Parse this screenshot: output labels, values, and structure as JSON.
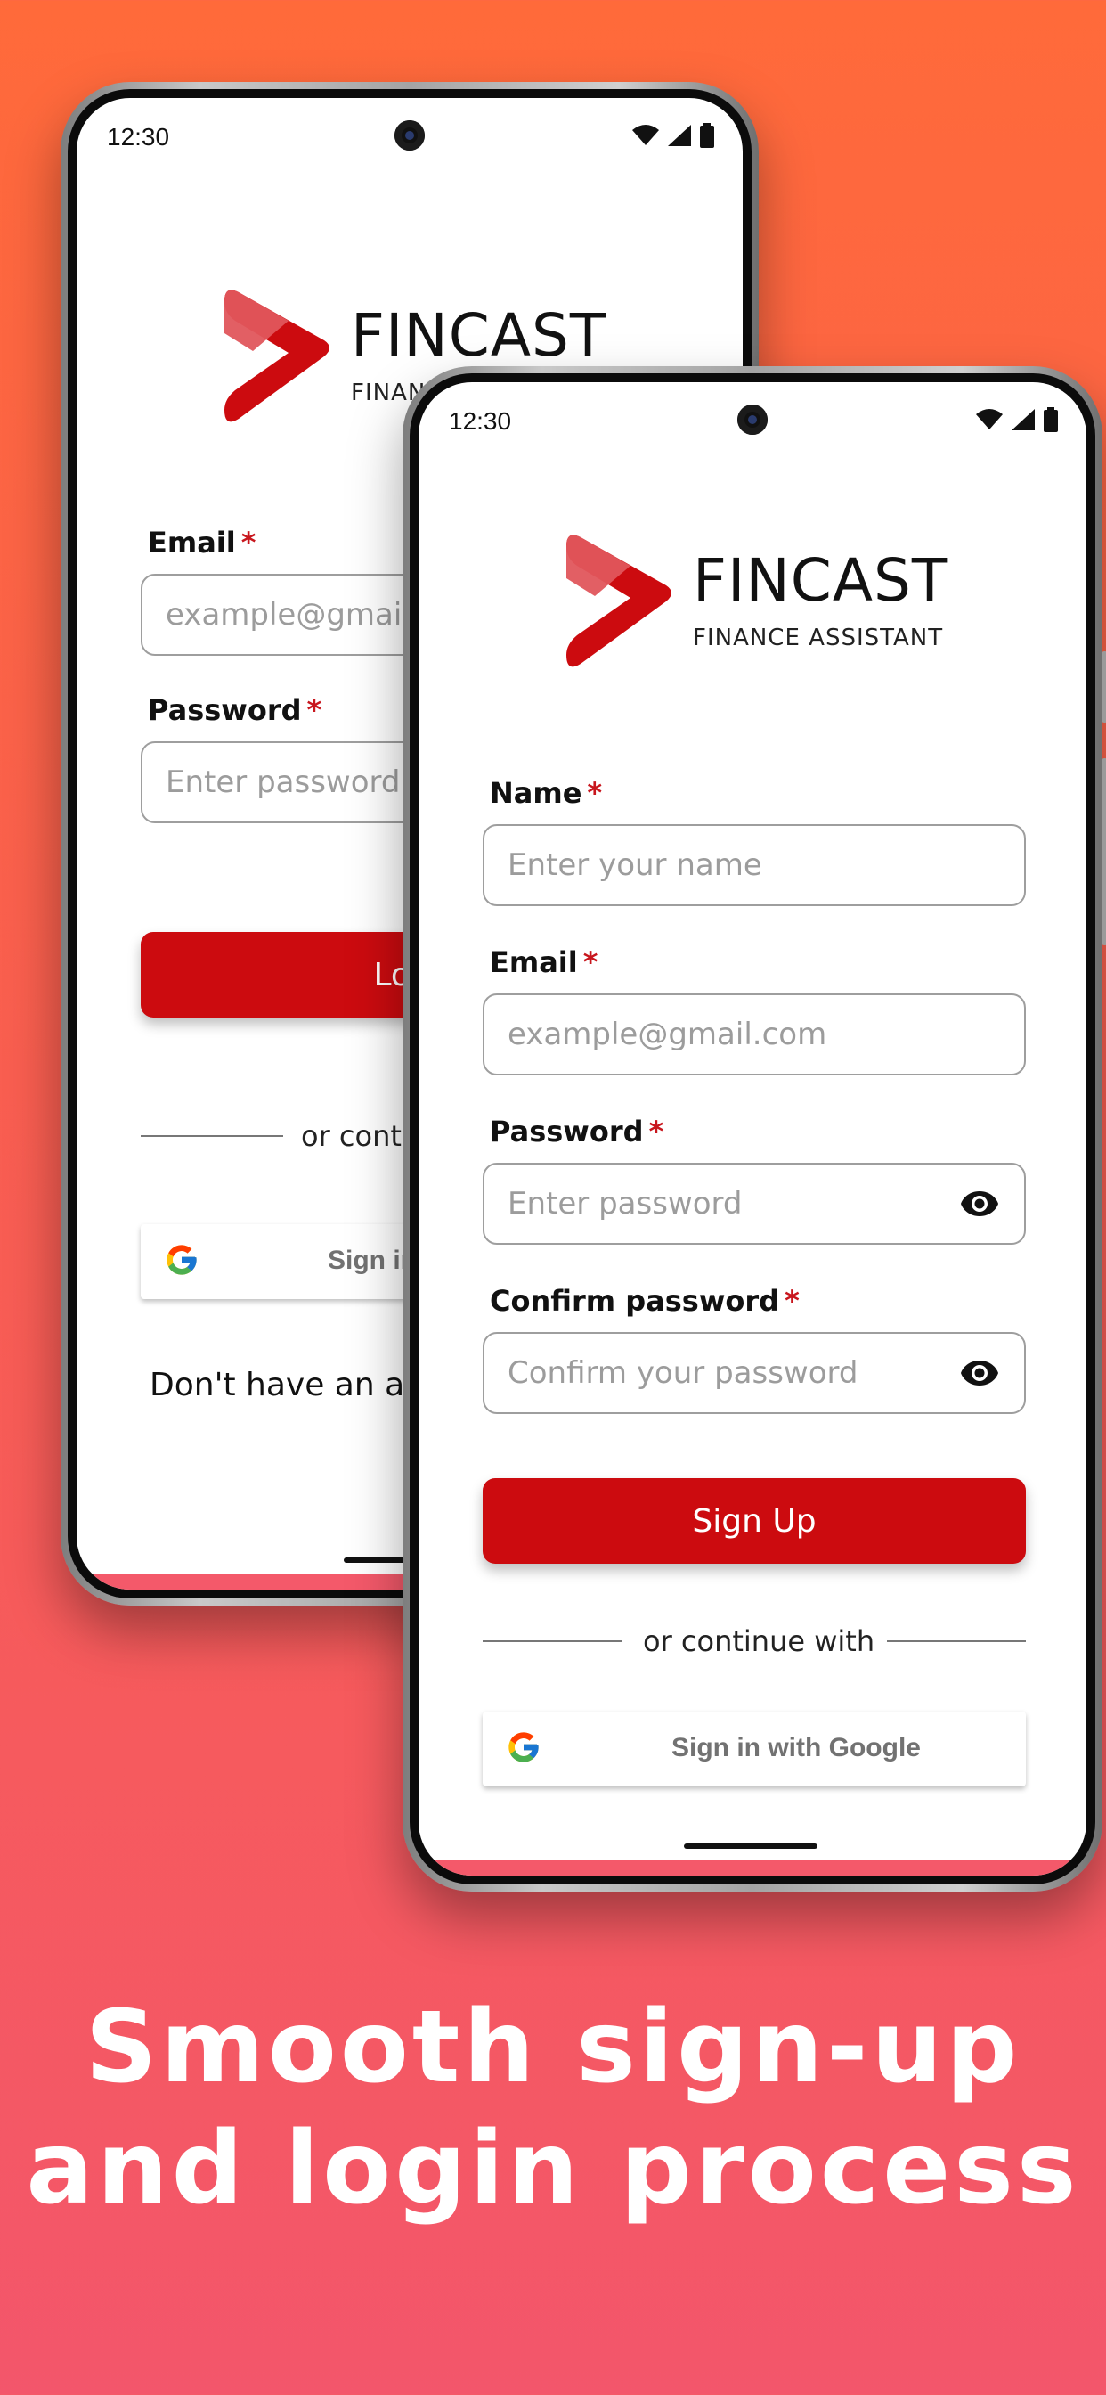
{
  "back_phone": {
    "status_time": "12:30",
    "brand": "FINCAST",
    "tagline": "FINANCE ASSISTANT",
    "email_label": "Email",
    "email_placeholder": "example@gmail.com",
    "password_label": "Password",
    "password_placeholder": "Enter password",
    "login_label": "Login",
    "divider_text": "or continue with",
    "google_label": "Sign in with Google",
    "signup_prompt": "Don't have an account?"
  },
  "front_phone": {
    "status_time": "12:30",
    "brand": "FINCAST",
    "tagline": "FINANCE ASSISTANT",
    "name_label": "Name",
    "name_placeholder": "Enter your name",
    "email_label": "Email",
    "email_placeholder": "example@gmail.com",
    "password_label": "Password",
    "password_placeholder": "Enter password",
    "confirm_label": "Confirm password",
    "confirm_placeholder": "Confirm your password",
    "signup_label": "Sign Up",
    "divider_text": "or continue with",
    "google_label": "Sign in with Google"
  },
  "required_marker": "*",
  "headline": {
    "line1": "Smooth sign-up",
    "line2": "and login process"
  },
  "colors": {
    "accent": "#cc0b0f",
    "background_top": "#ff6a3a",
    "background_bottom": "#f3566b"
  },
  "icons": [
    "camera-icon",
    "wifi-icon",
    "signal-icon",
    "battery-icon",
    "fincast-logo-icon",
    "eye-icon",
    "google-icon"
  ]
}
